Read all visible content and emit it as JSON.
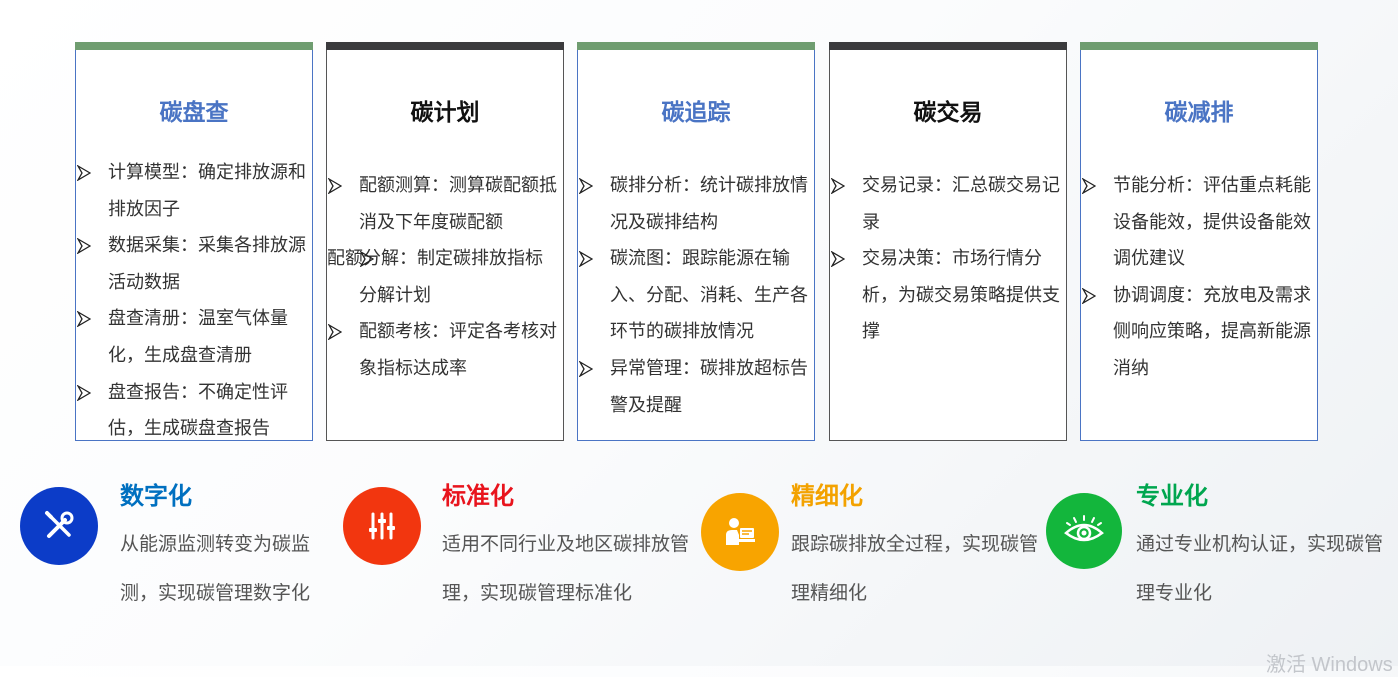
{
  "cards": [
    {
      "title": "碳盘查",
      "items": [
        "计算模型：确定排放源和排放因子",
        "数据采集：采集各排放源活动数据",
        "盘查清册：温室气体量化，生成盘查清册",
        "盘查报告：不确定性评估，生成碳盘查报告"
      ]
    },
    {
      "title": "碳计划",
      "items": [
        "配额测算：测算碳配额抵消及下年度碳配额",
        "配额分解：制定碳排放指标分解计划",
        "配额考核：评定各考核对象指标达成率"
      ]
    },
    {
      "title": "碳追踪",
      "items": [
        "碳排分析：统计碳排放情况及碳排结构",
        "碳流图：跟踪能源在输入、分配、消耗、生产各环节的碳排放情况",
        "异常管理：碳排放超标告警及提醒"
      ]
    },
    {
      "title": "碳交易",
      "items": [
        "交易记录：汇总碳交易记录",
        "交易决策：市场行情分析，为碳交易策略提供支撑"
      ]
    },
    {
      "title": "碳减排",
      "items": [
        "节能分析：评估重点耗能设备能效，提供设备能效调优建议",
        "协调调度：充放电及需求侧响应策略，提高新能源消纳"
      ]
    }
  ],
  "features": [
    {
      "title": "数字化",
      "desc": "从能源监测转变为碳监测，实现碳管理数字化",
      "color": "#0070c0",
      "circle_color": "#0c3cc8",
      "icon": "wrench-screwdriver-icon"
    },
    {
      "title": "标准化",
      "desc": "适用不同行业及地区碳排放管理，实现碳管理标准化",
      "color": "#e8141d",
      "circle_color": "#f2360f",
      "icon": "sliders-icon"
    },
    {
      "title": "精细化",
      "desc": "跟踪碳排放全过程，实现碳管理精细化",
      "color": "#f3a200",
      "circle_color": "#f8a400",
      "icon": "operator-icon"
    },
    {
      "title": "专业化",
      "desc": "通过专业机构认证，实现碳管理专业化",
      "color": "#00a64f",
      "circle_color": "#13b63c",
      "icon": "eye-icon"
    }
  ],
  "watermark": "激活 Windows"
}
